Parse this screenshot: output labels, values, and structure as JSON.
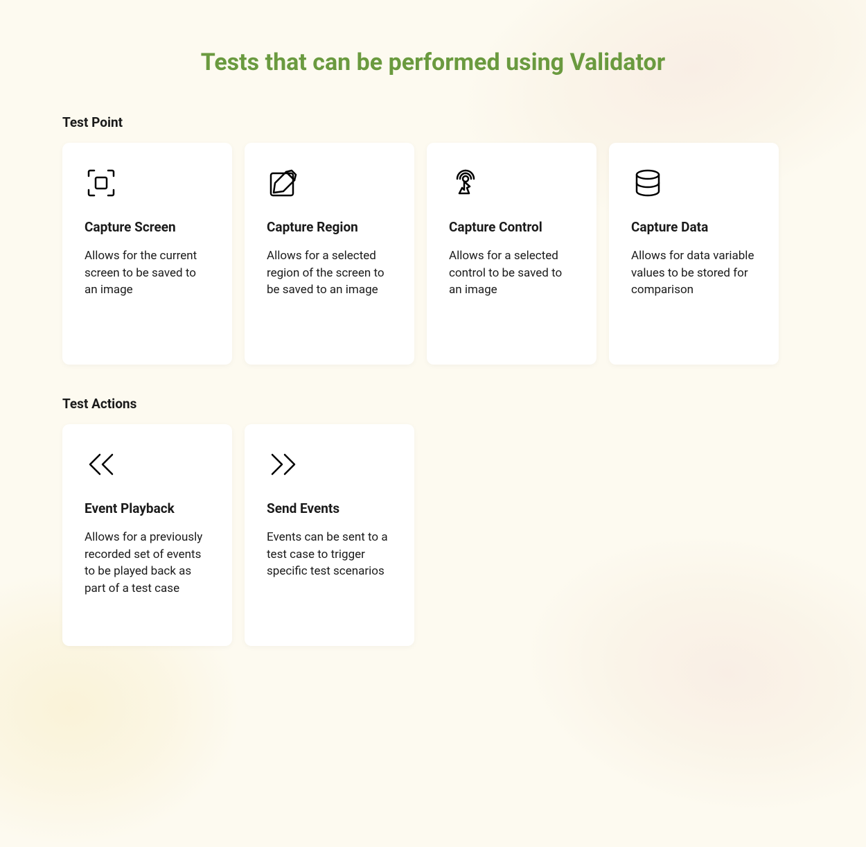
{
  "title": "Tests that can be performed using Validator",
  "sections": [
    {
      "heading": "Test Point",
      "cards": [
        {
          "icon": "capture-screen-icon",
          "title": "Capture Screen",
          "desc": "Allows for the current screen to be saved to an image"
        },
        {
          "icon": "capture-region-icon",
          "title": "Capture Region",
          "desc": "Allows for a selected region of the screen to be saved to an image"
        },
        {
          "icon": "capture-control-icon",
          "title": "Capture Control",
          "desc": "Allows for a selected control to be saved to an image"
        },
        {
          "icon": "capture-data-icon",
          "title": "Capture Data",
          "desc": "Allows for data variable values to be stored for comparison"
        }
      ]
    },
    {
      "heading": "Test Actions",
      "cards": [
        {
          "icon": "event-playback-icon",
          "title": "Event Playback",
          "desc": "Allows for a previously recorded set of events to be played back as part of a test case"
        },
        {
          "icon": "send-events-icon",
          "title": "Send Events",
          "desc": "Events can be sent to a test case to trigger specific test scenarios"
        }
      ]
    }
  ]
}
